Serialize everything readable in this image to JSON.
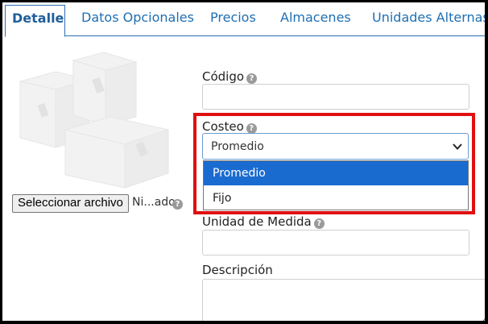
{
  "tabs": [
    {
      "label": "Detalle",
      "active": true
    },
    {
      "label": "Datos Opcionales",
      "active": false
    },
    {
      "label": "Precios",
      "active": false
    },
    {
      "label": "Almacenes",
      "active": false
    },
    {
      "label": "Unidades Alternas",
      "active": false
    }
  ],
  "file_picker": {
    "button_label": "Seleccionar archivo",
    "file_name": "Ni...ado"
  },
  "fields": {
    "codigo": {
      "label": "Código",
      "value": ""
    },
    "costeo": {
      "label": "Costeo",
      "selected": "Promedio",
      "options": [
        "Promedio",
        "Fijo"
      ],
      "highlighted_option": "Promedio"
    },
    "unidad_medida": {
      "label": "Unidad de Medida",
      "value": ""
    },
    "descripcion": {
      "label": "Descripción",
      "value": ""
    }
  },
  "help_glyph": "?",
  "colors": {
    "tab_text": "#1f6fb2",
    "tab_border": "#2a6fb0",
    "option_highlight": "#1a6bd0",
    "annotation_box": "#e01010",
    "help_icon": "#9a9a9a"
  },
  "icons": {
    "help": "question-circle-icon",
    "select_arrow": "chevron-down-icon",
    "product_placeholder": "boxes-placeholder-image"
  }
}
